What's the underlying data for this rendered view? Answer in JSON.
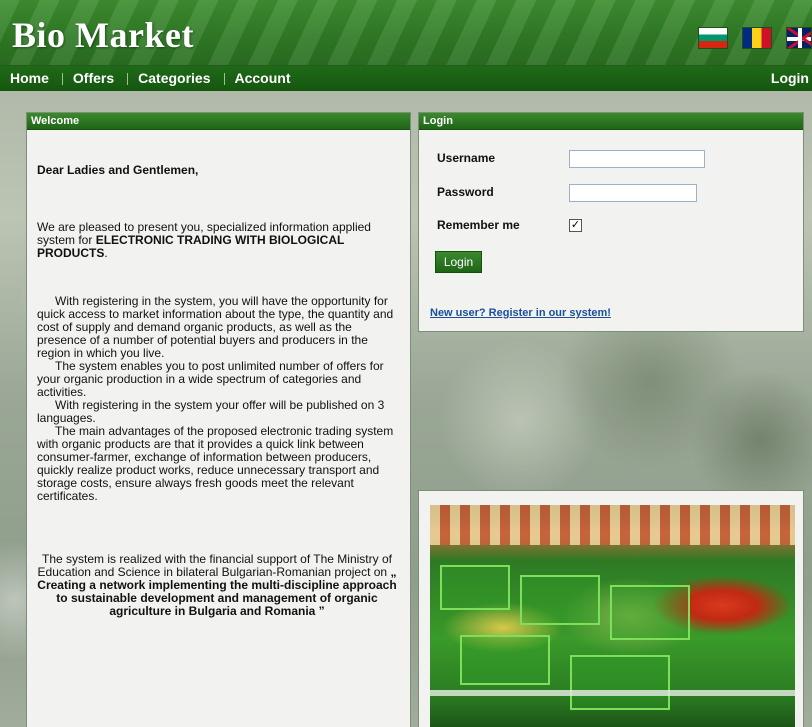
{
  "header": {
    "logo": "Bio Market",
    "flags": [
      "bulgaria-flag-icon",
      "romania-flag-icon",
      "uk-flag-icon"
    ]
  },
  "nav": {
    "items": [
      {
        "label": "Home"
      },
      {
        "label": "Offers"
      },
      {
        "label": "Categories"
      },
      {
        "label": "Account"
      }
    ],
    "login": "Login"
  },
  "welcome": {
    "title": "Welcome",
    "greeting": "Dear Ladies and Gentlemen,",
    "intro": "We are pleased to present you, specialized information applied system for ",
    "intro_bold": "ELECTRONIC TRADING WITH BIOLOGICAL PRODUCTS",
    "intro_end": ".",
    "p_register": "With registering in the system, you will have the opportunity for quick access to market information about the type, the quantity and cost of supply and demand organic products, as well as the presence of a number of potential buyers and producers in the region in which you live.",
    "p_offers": "The system enables you to post unlimited number of offers for your organic production in a wide spectrum of categories and activities.",
    "p_languages": "With registering in the system your offer will be published on 3 languages.",
    "p_advantages": "The main advantages of the proposed electronic trading system with organic products are that it provides a quick link between consumer-farmer, exchange of information between producers, quickly realize product works, reduce unnecessary transport and storage costs, ensure always fresh goods meet the relevant certificates.",
    "funding": "The system is realized with the financial support of The Ministry of Education and Science in bilateral Bulgarian-Romanian project on ",
    "funding_bold": "„ Creating a network implementing the multi-discipline approach to sustainable development and management of organic agriculture in Bulgaria and Romania ”"
  },
  "login": {
    "title": "Login",
    "username_label": "Username",
    "username_value": "",
    "password_label": "Password",
    "password_value": "",
    "remember_label": "Remember me",
    "remember_checked": true,
    "checkmark": "✓",
    "button": "Login",
    "register_link": "New user? Register in our system!"
  },
  "colors": {
    "header_green": "#2f7a25",
    "nav_green": "#1f6a18",
    "link_blue": "#1a4f99"
  }
}
